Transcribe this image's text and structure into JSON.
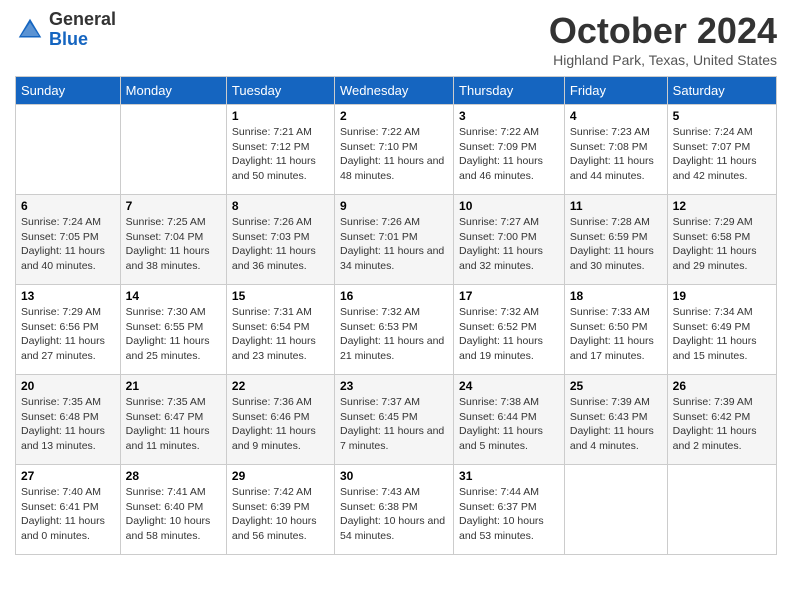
{
  "header": {
    "logo_general": "General",
    "logo_blue": "Blue",
    "title": "October 2024",
    "subtitle": "Highland Park, Texas, United States"
  },
  "days_of_week": [
    "Sunday",
    "Monday",
    "Tuesday",
    "Wednesday",
    "Thursday",
    "Friday",
    "Saturday"
  ],
  "weeks": [
    [
      {
        "day": "",
        "sunrise": "",
        "sunset": "",
        "daylight": ""
      },
      {
        "day": "",
        "sunrise": "",
        "sunset": "",
        "daylight": ""
      },
      {
        "day": "1",
        "sunrise": "Sunrise: 7:21 AM",
        "sunset": "Sunset: 7:12 PM",
        "daylight": "Daylight: 11 hours and 50 minutes."
      },
      {
        "day": "2",
        "sunrise": "Sunrise: 7:22 AM",
        "sunset": "Sunset: 7:10 PM",
        "daylight": "Daylight: 11 hours and 48 minutes."
      },
      {
        "day": "3",
        "sunrise": "Sunrise: 7:22 AM",
        "sunset": "Sunset: 7:09 PM",
        "daylight": "Daylight: 11 hours and 46 minutes."
      },
      {
        "day": "4",
        "sunrise": "Sunrise: 7:23 AM",
        "sunset": "Sunset: 7:08 PM",
        "daylight": "Daylight: 11 hours and 44 minutes."
      },
      {
        "day": "5",
        "sunrise": "Sunrise: 7:24 AM",
        "sunset": "Sunset: 7:07 PM",
        "daylight": "Daylight: 11 hours and 42 minutes."
      }
    ],
    [
      {
        "day": "6",
        "sunrise": "Sunrise: 7:24 AM",
        "sunset": "Sunset: 7:05 PM",
        "daylight": "Daylight: 11 hours and 40 minutes."
      },
      {
        "day": "7",
        "sunrise": "Sunrise: 7:25 AM",
        "sunset": "Sunset: 7:04 PM",
        "daylight": "Daylight: 11 hours and 38 minutes."
      },
      {
        "day": "8",
        "sunrise": "Sunrise: 7:26 AM",
        "sunset": "Sunset: 7:03 PM",
        "daylight": "Daylight: 11 hours and 36 minutes."
      },
      {
        "day": "9",
        "sunrise": "Sunrise: 7:26 AM",
        "sunset": "Sunset: 7:01 PM",
        "daylight": "Daylight: 11 hours and 34 minutes."
      },
      {
        "day": "10",
        "sunrise": "Sunrise: 7:27 AM",
        "sunset": "Sunset: 7:00 PM",
        "daylight": "Daylight: 11 hours and 32 minutes."
      },
      {
        "day": "11",
        "sunrise": "Sunrise: 7:28 AM",
        "sunset": "Sunset: 6:59 PM",
        "daylight": "Daylight: 11 hours and 30 minutes."
      },
      {
        "day": "12",
        "sunrise": "Sunrise: 7:29 AM",
        "sunset": "Sunset: 6:58 PM",
        "daylight": "Daylight: 11 hours and 29 minutes."
      }
    ],
    [
      {
        "day": "13",
        "sunrise": "Sunrise: 7:29 AM",
        "sunset": "Sunset: 6:56 PM",
        "daylight": "Daylight: 11 hours and 27 minutes."
      },
      {
        "day": "14",
        "sunrise": "Sunrise: 7:30 AM",
        "sunset": "Sunset: 6:55 PM",
        "daylight": "Daylight: 11 hours and 25 minutes."
      },
      {
        "day": "15",
        "sunrise": "Sunrise: 7:31 AM",
        "sunset": "Sunset: 6:54 PM",
        "daylight": "Daylight: 11 hours and 23 minutes."
      },
      {
        "day": "16",
        "sunrise": "Sunrise: 7:32 AM",
        "sunset": "Sunset: 6:53 PM",
        "daylight": "Daylight: 11 hours and 21 minutes."
      },
      {
        "day": "17",
        "sunrise": "Sunrise: 7:32 AM",
        "sunset": "Sunset: 6:52 PM",
        "daylight": "Daylight: 11 hours and 19 minutes."
      },
      {
        "day": "18",
        "sunrise": "Sunrise: 7:33 AM",
        "sunset": "Sunset: 6:50 PM",
        "daylight": "Daylight: 11 hours and 17 minutes."
      },
      {
        "day": "19",
        "sunrise": "Sunrise: 7:34 AM",
        "sunset": "Sunset: 6:49 PM",
        "daylight": "Daylight: 11 hours and 15 minutes."
      }
    ],
    [
      {
        "day": "20",
        "sunrise": "Sunrise: 7:35 AM",
        "sunset": "Sunset: 6:48 PM",
        "daylight": "Daylight: 11 hours and 13 minutes."
      },
      {
        "day": "21",
        "sunrise": "Sunrise: 7:35 AM",
        "sunset": "Sunset: 6:47 PM",
        "daylight": "Daylight: 11 hours and 11 minutes."
      },
      {
        "day": "22",
        "sunrise": "Sunrise: 7:36 AM",
        "sunset": "Sunset: 6:46 PM",
        "daylight": "Daylight: 11 hours and 9 minutes."
      },
      {
        "day": "23",
        "sunrise": "Sunrise: 7:37 AM",
        "sunset": "Sunset: 6:45 PM",
        "daylight": "Daylight: 11 hours and 7 minutes."
      },
      {
        "day": "24",
        "sunrise": "Sunrise: 7:38 AM",
        "sunset": "Sunset: 6:44 PM",
        "daylight": "Daylight: 11 hours and 5 minutes."
      },
      {
        "day": "25",
        "sunrise": "Sunrise: 7:39 AM",
        "sunset": "Sunset: 6:43 PM",
        "daylight": "Daylight: 11 hours and 4 minutes."
      },
      {
        "day": "26",
        "sunrise": "Sunrise: 7:39 AM",
        "sunset": "Sunset: 6:42 PM",
        "daylight": "Daylight: 11 hours and 2 minutes."
      }
    ],
    [
      {
        "day": "27",
        "sunrise": "Sunrise: 7:40 AM",
        "sunset": "Sunset: 6:41 PM",
        "daylight": "Daylight: 11 hours and 0 minutes."
      },
      {
        "day": "28",
        "sunrise": "Sunrise: 7:41 AM",
        "sunset": "Sunset: 6:40 PM",
        "daylight": "Daylight: 10 hours and 58 minutes."
      },
      {
        "day": "29",
        "sunrise": "Sunrise: 7:42 AM",
        "sunset": "Sunset: 6:39 PM",
        "daylight": "Daylight: 10 hours and 56 minutes."
      },
      {
        "day": "30",
        "sunrise": "Sunrise: 7:43 AM",
        "sunset": "Sunset: 6:38 PM",
        "daylight": "Daylight: 10 hours and 54 minutes."
      },
      {
        "day": "31",
        "sunrise": "Sunrise: 7:44 AM",
        "sunset": "Sunset: 6:37 PM",
        "daylight": "Daylight: 10 hours and 53 minutes."
      },
      {
        "day": "",
        "sunrise": "",
        "sunset": "",
        "daylight": ""
      },
      {
        "day": "",
        "sunrise": "",
        "sunset": "",
        "daylight": ""
      }
    ]
  ]
}
